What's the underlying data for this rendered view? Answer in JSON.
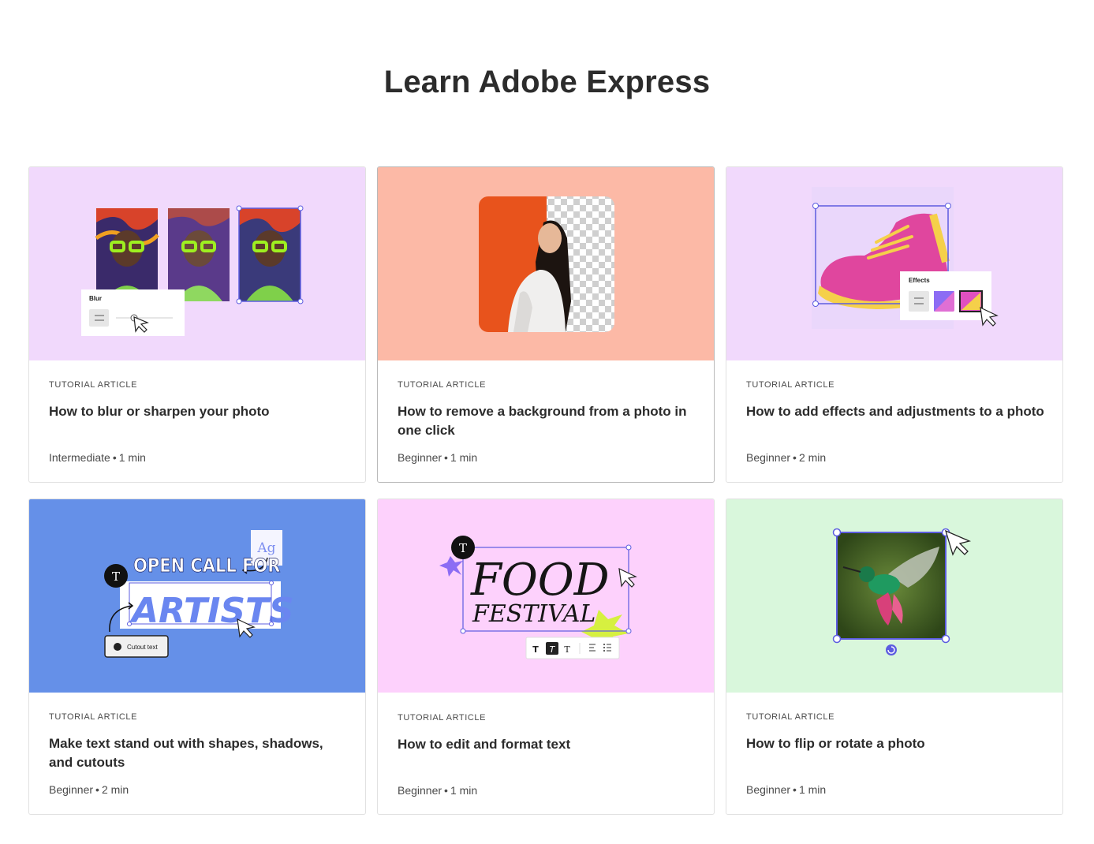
{
  "page": {
    "title": "Learn Adobe Express"
  },
  "cards": [
    {
      "eyebrow": "TUTORIAL ARTICLE",
      "title": "How to blur or sharpen your photo",
      "level": "Intermediate",
      "duration": "1 min",
      "thumb_bg": "#f1d9fc",
      "panel_label": "Blur"
    },
    {
      "eyebrow": "TUTORIAL ARTICLE",
      "title": "How to remove a background from a photo in one click",
      "level": "Beginner",
      "duration": "1 min",
      "thumb_bg": "#fcb9a6"
    },
    {
      "eyebrow": "TUTORIAL ARTICLE",
      "title": "How to add effects and adjustments to a photo",
      "level": "Beginner",
      "duration": "2 min",
      "thumb_bg": "#f1d9fc",
      "panel_label": "Effects"
    },
    {
      "eyebrow": "TUTORIAL ARTICLE",
      "title": "Make text stand out with shapes, shadows, and cutouts",
      "level": "Beginner",
      "duration": "2 min",
      "thumb_bg": "#6590e8",
      "art_line1": "OPEN CALL FOR",
      "art_line2": "ARTISTS",
      "chip_label": "Cutout text",
      "font_sample": "Ag"
    },
    {
      "eyebrow": "TUTORIAL ARTICLE",
      "title": "How to edit and format text",
      "level": "Beginner",
      "duration": "1 min",
      "thumb_bg": "#fdd1fc",
      "art_line1": "FOOD",
      "art_line2": "FESTIVAL"
    },
    {
      "eyebrow": "TUTORIAL ARTICLE",
      "title": "How to flip or rotate a photo",
      "level": "Beginner",
      "duration": "1 min",
      "thumb_bg": "#d9f7dc"
    }
  ],
  "icons": {
    "text_tool": "text-t-icon",
    "cursor": "cursor-arrow-icon",
    "adjust": "sliders-icon",
    "rotate": "rotate-icon"
  },
  "colors": {
    "selection": "#5c5ce0",
    "title_text": "#2c2c2c",
    "meta_text": "#4b4b4b"
  }
}
